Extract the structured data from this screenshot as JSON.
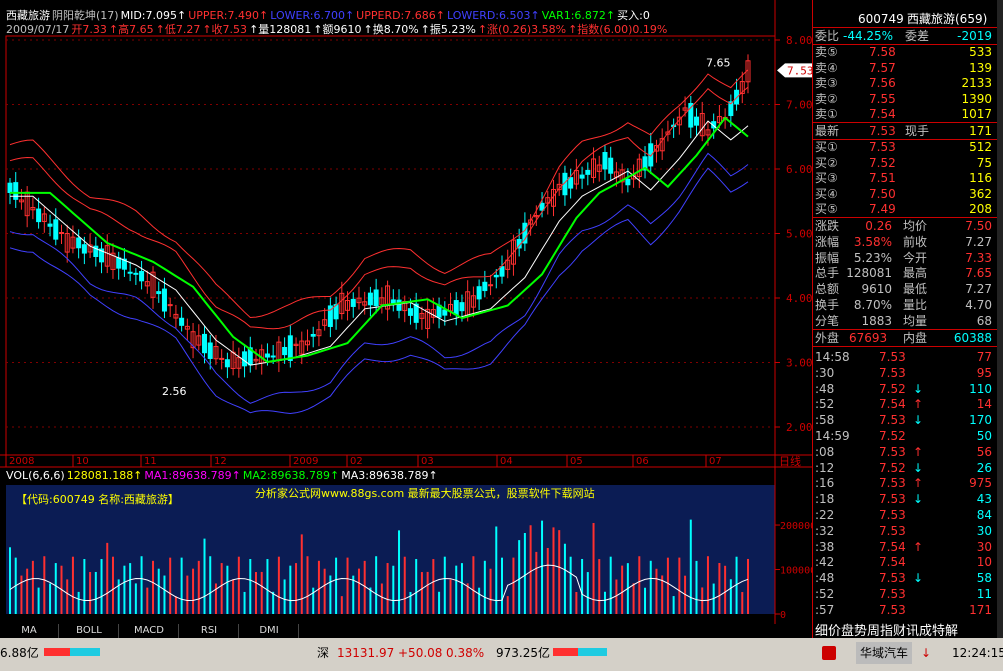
{
  "header": {
    "line1": [
      {
        "text": "西藏旅游",
        "color": "#ffffff"
      },
      {
        "text": "阴阳乾坤(17)",
        "color": "#c0c0c0"
      },
      {
        "text": "MID:7.095↑",
        "color": "#ffffff"
      },
      {
        "text": "UPPER:7.490↑",
        "color": "#ff3030"
      },
      {
        "text": "LOWER:6.700↑",
        "color": "#4040ff"
      },
      {
        "text": "UPPERD:7.686↑",
        "color": "#ff3030"
      },
      {
        "text": "LOWERD:6.503↑",
        "color": "#4040ff"
      },
      {
        "text": "VAR1:6.872↑",
        "color": "#00ff00"
      },
      {
        "text": "买入:0",
        "color": "#ffffff"
      }
    ],
    "line2": [
      {
        "text": "2009/07/17",
        "color": "#c0c0c0"
      },
      {
        "text": "开7.33",
        "color": "#ff3030"
      },
      {
        "text": "↑高7.65",
        "color": "#ff3030"
      },
      {
        "text": "↑低7.27",
        "color": "#ff3030"
      },
      {
        "text": "↑收7.53",
        "color": "#ff3030"
      },
      {
        "text": "↑量128081",
        "color": "#ffffff"
      },
      {
        "text": "↑额9610",
        "color": "#ffffff"
      },
      {
        "text": "↑换8.70%",
        "color": "#ffffff"
      },
      {
        "text": "↑振5.23%",
        "color": "#ffffff"
      },
      {
        "text": "↑涨(0.26)3.58%",
        "color": "#ff3030"
      },
      {
        "text": "↑指数(6.00)0.19%",
        "color": "#ff3030"
      }
    ]
  },
  "price_axis": {
    "labels": [
      "8.00",
      "7.00",
      "6.00",
      "5.00",
      "4.00",
      "3.00",
      "2.00"
    ],
    "current_price_tag": "7.53"
  },
  "price_annotations": {
    "high": "7.65",
    "low": "2.56"
  },
  "time_axis": {
    "labels": [
      "2008",
      "10",
      "11",
      "12",
      "2009",
      "02",
      "03",
      "04",
      "05",
      "06",
      "07"
    ],
    "corner": "日线"
  },
  "volume_header": [
    {
      "text": "VOL(6,6,6)",
      "color": "#ffffff"
    },
    {
      "text": "128081.188↑",
      "color": "#ffff00"
    },
    {
      "text": "MA1:89638.789↑",
      "color": "#ff00ff"
    },
    {
      "text": "MA2:89638.789↑",
      "color": "#00ff00"
    },
    {
      "text": "MA3:89638.789↑",
      "color": "#ffffff"
    }
  ],
  "volume_panel": {
    "code_label": "【代码:600749 名称:西藏旅游】",
    "banner": "分析家公式网www.88gs.com 最新最大股票公式，股票软件下载网站",
    "axis_labels": [
      "200000",
      "100000",
      "0"
    ]
  },
  "bottom_tabs": [
    "MA",
    "BOLL",
    "MACD",
    "RSI",
    "DMI"
  ],
  "quote": {
    "title_code": "600749",
    "title_name": "西藏旅游(659)",
    "weibi_label": "委比",
    "weibi_value": "-44.25%",
    "weicha_label": "委差",
    "weicha_value": "-2019",
    "asks": [
      {
        "label": "卖⑤",
        "price": "7.58",
        "vol": "533"
      },
      {
        "label": "卖④",
        "price": "7.57",
        "vol": "139"
      },
      {
        "label": "卖③",
        "price": "7.56",
        "vol": "2133"
      },
      {
        "label": "卖②",
        "price": "7.55",
        "vol": "1390"
      },
      {
        "label": "卖①",
        "price": "7.54",
        "vol": "1017"
      }
    ],
    "latest_label": "最新",
    "latest_value": "7.53",
    "xianshou_label": "现手",
    "xianshou_value": "171",
    "bids": [
      {
        "label": "买①",
        "price": "7.53",
        "vol": "512"
      },
      {
        "label": "买②",
        "price": "7.52",
        "vol": "75"
      },
      {
        "label": "买③",
        "price": "7.51",
        "vol": "116"
      },
      {
        "label": "买④",
        "price": "7.50",
        "vol": "362"
      },
      {
        "label": "买⑤",
        "price": "7.49",
        "vol": "208"
      }
    ],
    "stats": [
      {
        "l1": "涨跌",
        "v1": "0.26",
        "c1": "#ff3030",
        "l2": "均价",
        "v2": "7.50",
        "c2": "#ff3030"
      },
      {
        "l1": "涨幅",
        "v1": "3.58%",
        "c1": "#ff3030",
        "l2": "前收",
        "v2": "7.27",
        "c2": "#c0c0c0"
      },
      {
        "l1": "振幅",
        "v1": "5.23%",
        "c1": "#c0c0c0",
        "l2": "今开",
        "v2": "7.33",
        "c2": "#ff3030"
      },
      {
        "l1": "总手",
        "v1": "128081",
        "c1": "#c0c0c0",
        "l2": "最高",
        "v2": "7.65",
        "c2": "#ff3030"
      },
      {
        "l1": "总额",
        "v1": "9610",
        "c1": "#c0c0c0",
        "l2": "最低",
        "v2": "7.27",
        "c2": "#c0c0c0"
      },
      {
        "l1": "换手",
        "v1": "8.70%",
        "c1": "#c0c0c0",
        "l2": "量比",
        "v2": "4.70",
        "c2": "#c0c0c0"
      },
      {
        "l1": "分笔",
        "v1": "1883",
        "c1": "#c0c0c0",
        "l2": "均量",
        "v2": "68",
        "c2": "#c0c0c0"
      }
    ],
    "waipan_label": "外盘",
    "waipan_value": "67693",
    "neipan_label": "内盘",
    "neipan_value": "60388",
    "ticks": [
      {
        "time": "14:58",
        "price": "7.53",
        "arrow": "",
        "vol": "77",
        "vc": "#ff3030"
      },
      {
        "time": ":30",
        "price": "7.53",
        "arrow": "",
        "vol": "95",
        "vc": "#ff3030"
      },
      {
        "time": ":48",
        "price": "7.52",
        "arrow": "↓",
        "vol": "110",
        "vc": "#00ffff"
      },
      {
        "time": ":52",
        "price": "7.54",
        "arrow": "↑",
        "vol": "14",
        "vc": "#ff3030"
      },
      {
        "time": ":58",
        "price": "7.53",
        "arrow": "↓",
        "vol": "170",
        "vc": "#00ffff"
      },
      {
        "time": "14:59",
        "price": "7.52",
        "arrow": "",
        "vol": "50",
        "vc": "#00ffff"
      },
      {
        "time": ":08",
        "price": "7.53",
        "arrow": "↑",
        "vol": "56",
        "vc": "#ff3030"
      },
      {
        "time": ":12",
        "price": "7.52",
        "arrow": "↓",
        "vol": "26",
        "vc": "#00ffff"
      },
      {
        "time": ":16",
        "price": "7.53",
        "arrow": "↑",
        "vol": "975",
        "vc": "#ff3030"
      },
      {
        "time": ":18",
        "price": "7.53",
        "arrow": "↓",
        "vol": "43",
        "vc": "#00ffff"
      },
      {
        "time": ":22",
        "price": "7.53",
        "arrow": "",
        "vol": "84",
        "vc": "#00ffff"
      },
      {
        "time": ":32",
        "price": "7.53",
        "arrow": "",
        "vol": "30",
        "vc": "#00ffff"
      },
      {
        "time": ":38",
        "price": "7.54",
        "arrow": "↑",
        "vol": "30",
        "vc": "#ff3030"
      },
      {
        "time": ":42",
        "price": "7.54",
        "arrow": "",
        "vol": "10",
        "vc": "#ff3030"
      },
      {
        "time": ":48",
        "price": "7.53",
        "arrow": "↓",
        "vol": "58",
        "vc": "#00ffff"
      },
      {
        "time": ":52",
        "price": "7.53",
        "arrow": "",
        "vol": "11",
        "vc": "#00ffff"
      },
      {
        "time": ":57",
        "price": "7.53",
        "arrow": "",
        "vol": "171",
        "vc": "#ff3030"
      }
    ],
    "right_tabs": "细价盘势周指财讯成特解"
  },
  "statusbar": {
    "left": "6.88亿",
    "shen_label": "深",
    "shen_index": "13131.97",
    "shen_change": "+50.08",
    "shen_pct": "0.38%",
    "shen_amount": "973.25亿",
    "ticker": "华域汽车",
    "clock": "12:24:15"
  },
  "colors": {
    "up": "#ff3030",
    "down": "#00ffff",
    "grid": "#800000"
  }
}
